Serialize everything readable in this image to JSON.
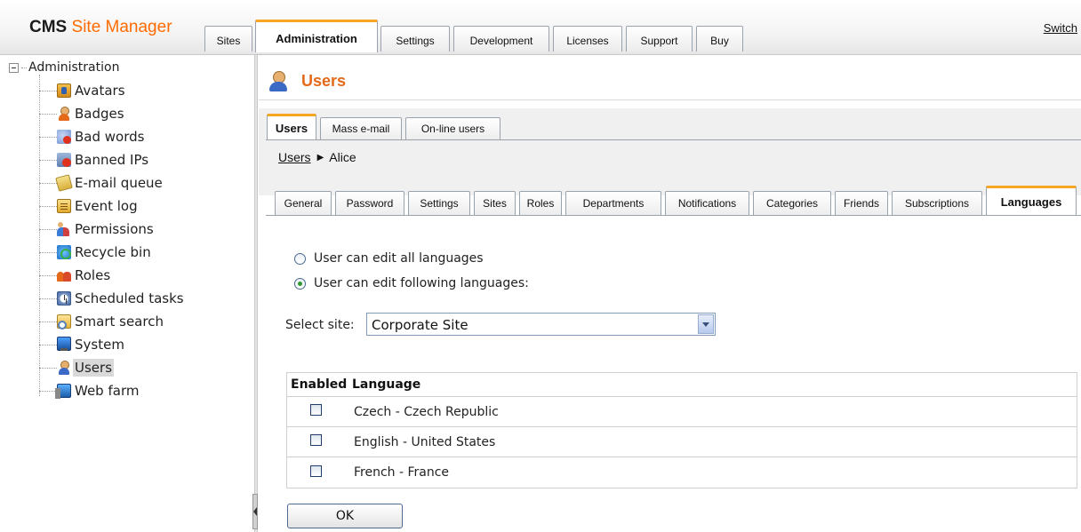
{
  "header": {
    "logo_bold": "CMS",
    "logo_rest": "Site Manager",
    "tabs": [
      {
        "label": "Sites"
      },
      {
        "label": "Administration"
      },
      {
        "label": "Settings"
      },
      {
        "label": "Development"
      },
      {
        "label": "Licenses"
      },
      {
        "label": "Support"
      },
      {
        "label": "Buy"
      }
    ],
    "active_tab": "Administration",
    "switch_link": "Switch"
  },
  "tree": {
    "root": "Administration",
    "items": [
      {
        "label": "Avatars",
        "icon": "avatars-icon"
      },
      {
        "label": "Badges",
        "icon": "badges-icon"
      },
      {
        "label": "Bad words",
        "icon": "bad-words-icon"
      },
      {
        "label": "Banned IPs",
        "icon": "banned-ips-icon"
      },
      {
        "label": "E-mail queue",
        "icon": "email-queue-icon"
      },
      {
        "label": "Event log",
        "icon": "event-log-icon"
      },
      {
        "label": "Permissions",
        "icon": "permissions-icon"
      },
      {
        "label": "Recycle bin",
        "icon": "recycle-bin-icon"
      },
      {
        "label": "Roles",
        "icon": "roles-icon"
      },
      {
        "label": "Scheduled tasks",
        "icon": "scheduled-tasks-icon"
      },
      {
        "label": "Smart search",
        "icon": "smart-search-icon"
      },
      {
        "label": "System",
        "icon": "system-icon"
      },
      {
        "label": "Users",
        "icon": "users-icon"
      },
      {
        "label": "Web farm",
        "icon": "web-farm-icon"
      }
    ],
    "selected": "Users"
  },
  "main": {
    "title": "Users",
    "subtabs": [
      {
        "label": "Users"
      },
      {
        "label": "Mass e-mail"
      },
      {
        "label": "On-line users"
      }
    ],
    "active_subtab": "Users",
    "breadcrumb": {
      "link": "Users",
      "separator": "▶",
      "current": "Alice"
    },
    "user_tabs": [
      {
        "label": "General"
      },
      {
        "label": "Password"
      },
      {
        "label": "Settings"
      },
      {
        "label": "Sites"
      },
      {
        "label": "Roles"
      },
      {
        "label": "Departments"
      },
      {
        "label": "Notifications"
      },
      {
        "label": "Categories"
      },
      {
        "label": "Friends"
      },
      {
        "label": "Subscriptions"
      },
      {
        "label": "Languages"
      }
    ],
    "active_user_tab": "Languages",
    "radio_all": "User can edit all languages",
    "radio_following": "User can edit following languages:",
    "radio_selected": "following",
    "select_label": "Select site:",
    "select_value": "Corporate Site",
    "table": {
      "headers": [
        "Enabled",
        "Language"
      ],
      "rows": [
        {
          "enabled": false,
          "language": "Czech - Czech Republic"
        },
        {
          "enabled": false,
          "language": "English - United States"
        },
        {
          "enabled": false,
          "language": "French - France"
        }
      ]
    },
    "ok_button": "OK"
  },
  "colors": {
    "accent_orange": "#e46a1a",
    "tab_highlight": "#f6a623",
    "tab_border": "#9aa3ad"
  }
}
